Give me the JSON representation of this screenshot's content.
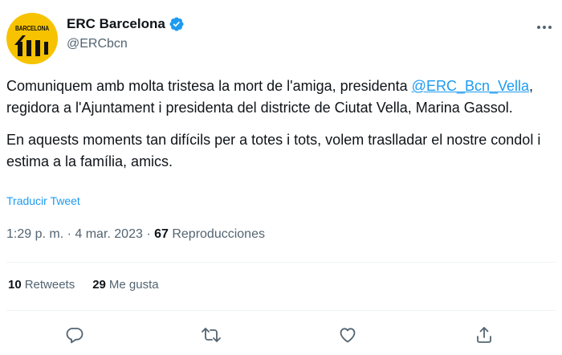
{
  "account": {
    "display_name": "ERC Barcelona",
    "handle": "@ERCbcn",
    "avatar_text": "BARCELONA",
    "verified": true
  },
  "tweet": {
    "para1_before": "Comuniquem amb molta tristesa la mort de l'amiga, presidenta ",
    "mention": "@ERC_Bcn_Vella",
    "para1_after": ", regidora a l'Ajuntament i presidenta del districte de Ciutat Vella, Marina Gassol.",
    "para2": "En aquests moments tan difícils per a totes i tots, volem traslladar el nostre condol i estima a la família, amics.",
    "translate_label": "Traducir Tweet"
  },
  "meta": {
    "time": "1:29 p. m.",
    "sep1": " · ",
    "date": "4 mar. 2023",
    "sep2": " · ",
    "views_count": "67",
    "views_label": " Reproducciones"
  },
  "stats": {
    "retweets_count": "10",
    "retweets_label": "Retweets",
    "likes_count": "29",
    "likes_label": "Me gusta"
  },
  "icons": {
    "reply": "reply-icon",
    "retweet": "retweet-icon",
    "like": "heart-icon",
    "share": "share-icon",
    "more": "more-icon",
    "verified": "verified-badge-icon"
  },
  "colors": {
    "link": "#1d9bf0",
    "secondary_text": "#536471",
    "avatar_bg": "#f7c300"
  }
}
